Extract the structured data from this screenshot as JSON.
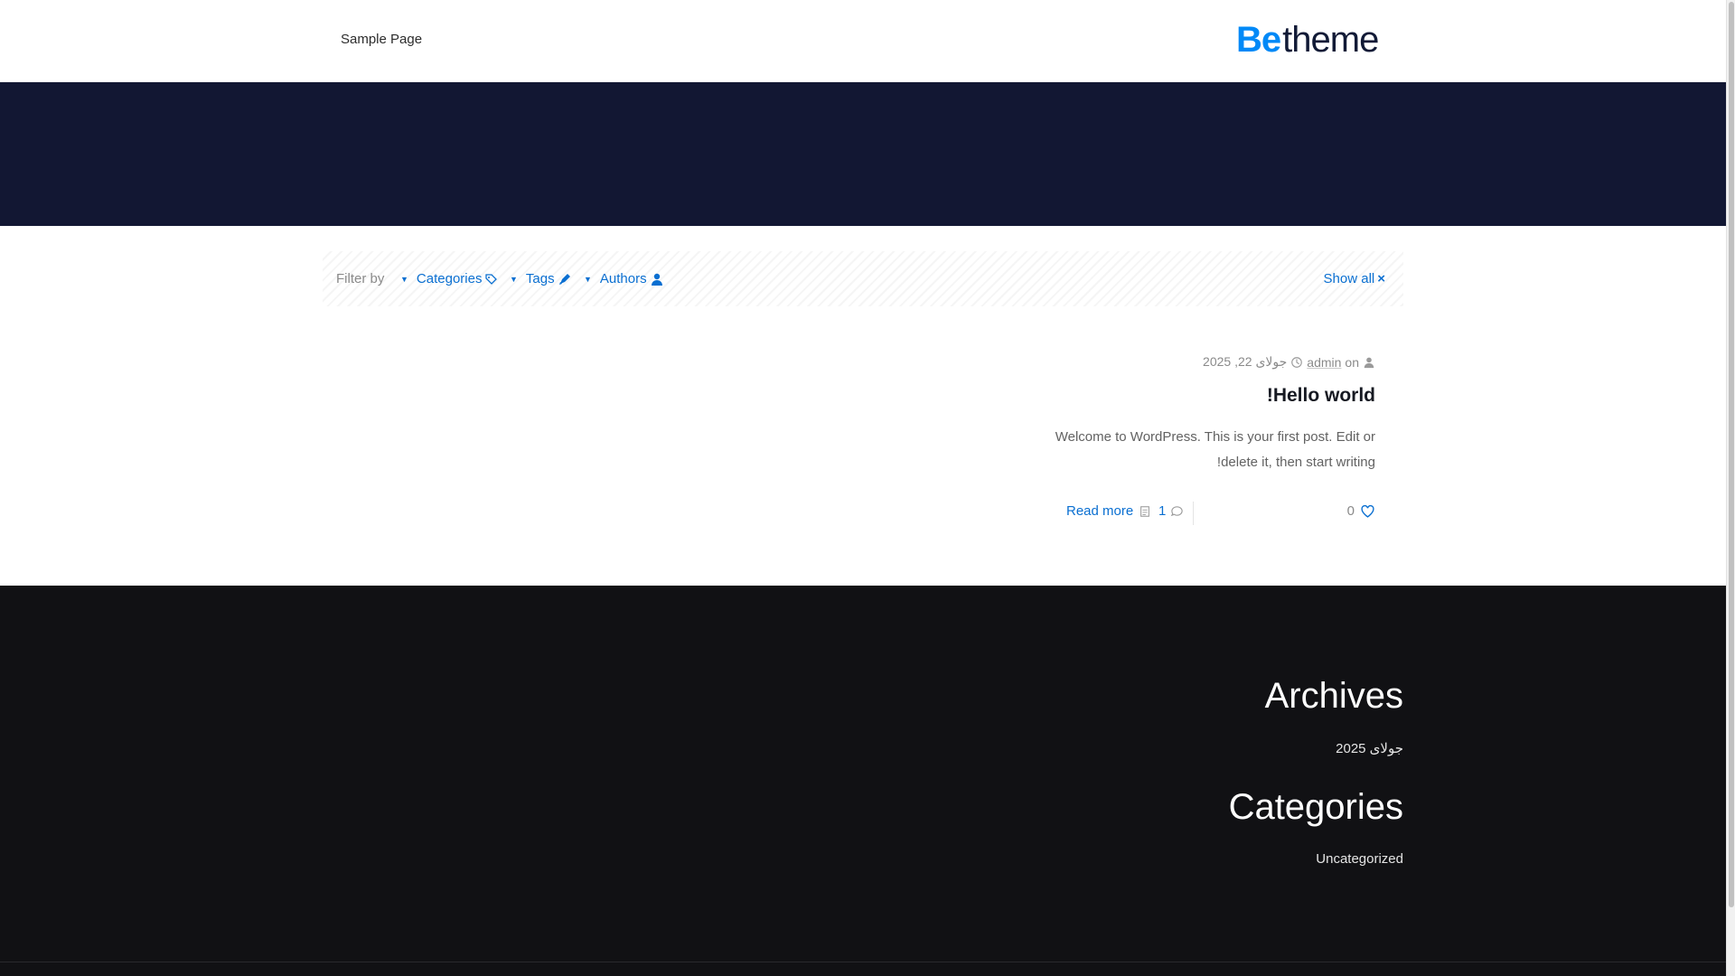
{
  "header": {
    "nav": [
      {
        "label": "Sample Page"
      }
    ],
    "logo": {
      "part1": "Be",
      "part2": "theme"
    }
  },
  "filters": {
    "label": "Filter by",
    "categories": "Categories",
    "tags": "Tags",
    "authors": "Authors",
    "show_all": "Show all"
  },
  "post": {
    "meta_on": "on",
    "author": "admin",
    "date": "جولای 22, 2025",
    "title": "Hello world!",
    "excerpt": "Welcome to WordPress. This is your first post. Edit or delete it, then start writing!",
    "likes": "0",
    "comments": "1",
    "read_more": "Read more"
  },
  "footer": {
    "archives_title": "Archives",
    "archives_item": "جولای 2025",
    "categories_title": "Categories",
    "categories_item": "Uncategorized"
  },
  "colors": {
    "accent": "#0089f7",
    "hero": "#121733",
    "footer": "#111114"
  }
}
